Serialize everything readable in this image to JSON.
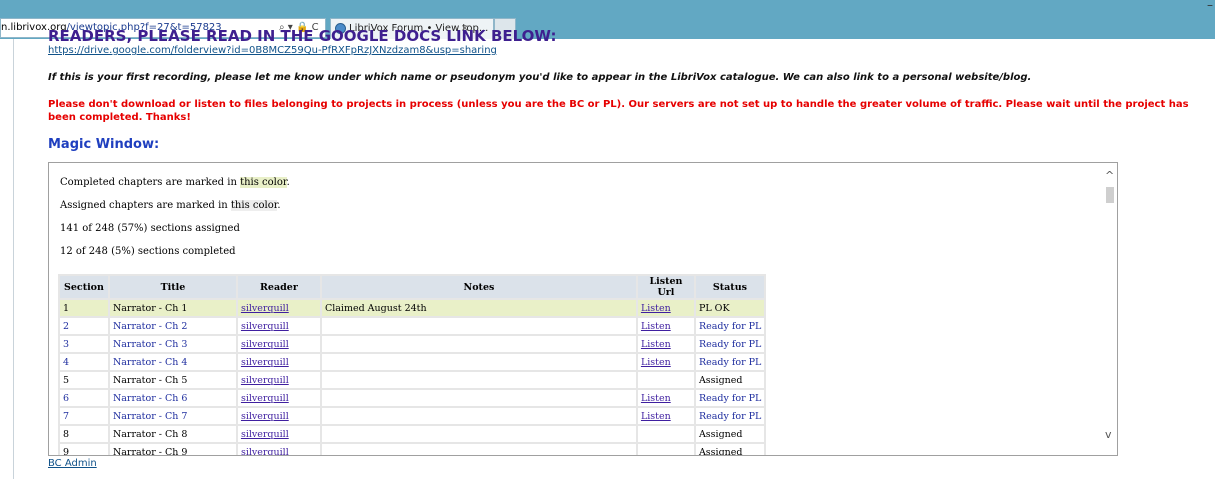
{
  "browser": {
    "address_host": "n.librivox.org",
    "address_path": "/viewtopic.php?f=27&t=57823",
    "address_icons": "⌕ ▾ 🔒 C",
    "tab_title": "LibriVox Forum • View top...",
    "tab_close": "×",
    "window_min": "–"
  },
  "page": {
    "clipped_heading": "READERS, PLEASE READ IN THE GOOGLE DOCS LINK BELOW:",
    "gdrive_link": "https://drive.google.com/folderview?id=0B8MCZ59Qu-PfRXFpRzJXNzdzam8&usp=sharing",
    "first_recording_note": "If this is your first recording, please let me know under which name or pseudonym you'd like to appear in the LibriVox catalogue. We can also link to a personal website/blog.",
    "warning": "Please don't download or listen to files belonging to projects in process (unless you are the BC or PL). Our servers are not set up to handle the greater volume of traffic. Please wait until the project has been completed. Thanks!",
    "magic_title": "Magic Window:",
    "bc_admin": "BC Admin"
  },
  "magic": {
    "completed_prefix": "Completed chapters are marked in ",
    "completed_swatch": "this color",
    "assigned_prefix": "Assigned chapters are marked in ",
    "assigned_swatch": "this color",
    "period": ".",
    "assigned_count": "141 of 248 (57%) sections assigned",
    "completed_count": "12 of 248 (5%) sections completed",
    "scroll_up": "^",
    "scroll_down": "v"
  },
  "table": {
    "headers": {
      "section": "Section",
      "title": "Title",
      "reader": "Reader",
      "notes": "Notes",
      "listen": "Listen Url",
      "status": "Status"
    },
    "rows": [
      {
        "section": "1",
        "title": "Narrator - Ch 1",
        "reader": "silverquill",
        "notes": "Claimed August 24th",
        "listen": "Listen",
        "status": "PL OK"
      },
      {
        "section": "2",
        "title": "Narrator - Ch 2",
        "reader": "silverquill",
        "notes": "",
        "listen": "Listen",
        "status": "Ready for PL"
      },
      {
        "section": "3",
        "title": "Narrator - Ch 3",
        "reader": "silverquill",
        "notes": "",
        "listen": "Listen",
        "status": "Ready for PL"
      },
      {
        "section": "4",
        "title": "Narrator - Ch 4",
        "reader": "silverquill",
        "notes": "",
        "listen": "Listen",
        "status": "Ready for PL"
      },
      {
        "section": "5",
        "title": "Narrator - Ch 5",
        "reader": "silverquill",
        "notes": "",
        "listen": "",
        "status": "Assigned"
      },
      {
        "section": "6",
        "title": "Narrator - Ch 6",
        "reader": "silverquill",
        "notes": "",
        "listen": "Listen",
        "status": "Ready for PL"
      },
      {
        "section": "7",
        "title": "Narrator - Ch 7",
        "reader": "silverquill",
        "notes": "",
        "listen": "Listen",
        "status": "Ready for PL"
      },
      {
        "section": "8",
        "title": "Narrator - Ch 8",
        "reader": "silverquill",
        "notes": "",
        "listen": "",
        "status": "Assigned"
      },
      {
        "section": "9",
        "title": "Narrator - Ch 9",
        "reader": "silverquill",
        "notes": "",
        "listen": "",
        "status": "Assigned"
      }
    ]
  },
  "colors": {
    "completed": "#e9f0c8",
    "assigned": "#eeeeee",
    "warning": "#e60000",
    "heading": "#1f3fbf",
    "ready": "#1f2e9f"
  }
}
